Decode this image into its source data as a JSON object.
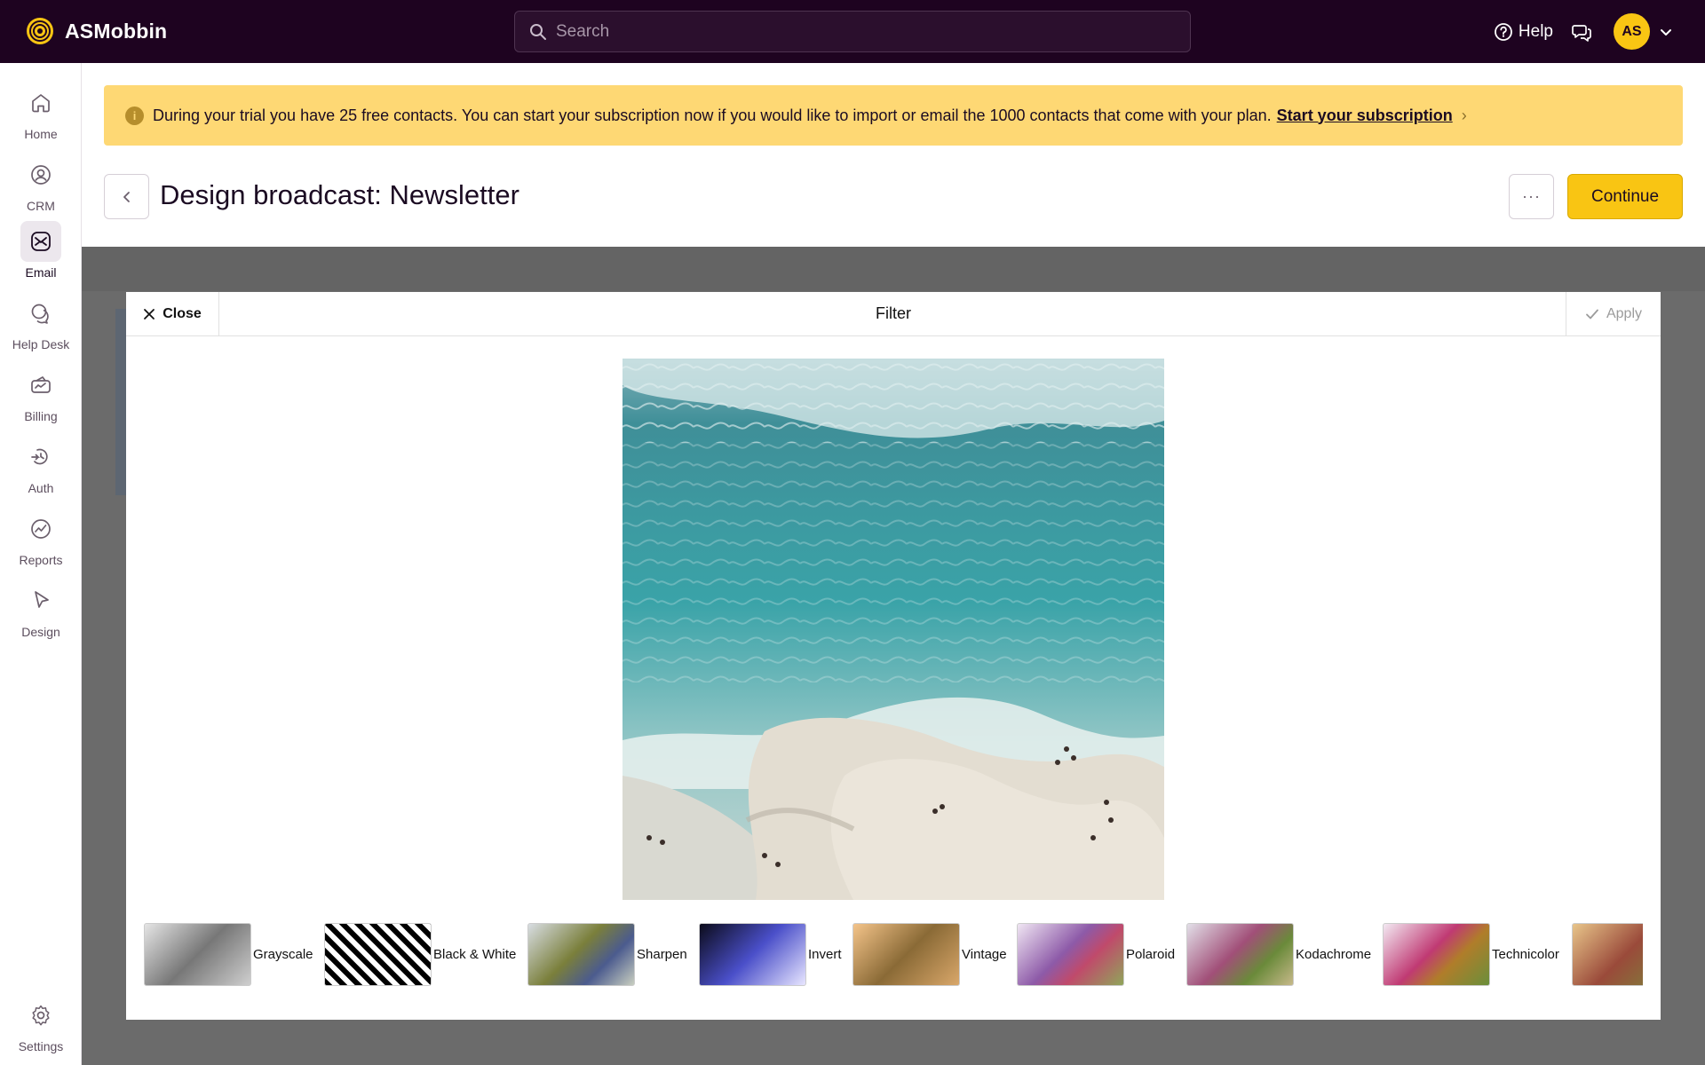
{
  "app": {
    "name": "ASMobbin",
    "search_placeholder": "Search",
    "help_label": "Help",
    "avatar_initials": "AS"
  },
  "sidebar": {
    "items": [
      {
        "label": "Home",
        "icon": "home-icon"
      },
      {
        "label": "CRM",
        "icon": "crm-icon"
      },
      {
        "label": "Email",
        "icon": "email-icon",
        "active": true
      },
      {
        "label": "Help Desk",
        "icon": "help-desk-icon"
      },
      {
        "label": "Billing",
        "icon": "billing-icon"
      },
      {
        "label": "Auth",
        "icon": "auth-icon"
      },
      {
        "label": "Reports",
        "icon": "reports-icon"
      },
      {
        "label": "Design",
        "icon": "design-icon"
      }
    ],
    "settings_label": "Settings"
  },
  "banner": {
    "text": "During your trial you have 25 free contacts. You can start your subscription now if you would like to import or email the 1000 contacts that come with your plan.",
    "link": "Start your subscription"
  },
  "header": {
    "title": "Design broadcast: Newsletter",
    "more_label": "···",
    "continue_label": "Continue"
  },
  "modal": {
    "close_label": "Close",
    "title": "Filter",
    "apply_label": "Apply",
    "filters": [
      {
        "label": "Grayscale"
      },
      {
        "label": "Black & White"
      },
      {
        "label": "Sharpen"
      },
      {
        "label": "Invert"
      },
      {
        "label": "Vintage"
      },
      {
        "label": "Polaroid"
      },
      {
        "label": "Kodachrome"
      },
      {
        "label": "Technicolor"
      },
      {
        "label": ""
      }
    ]
  },
  "colors": {
    "topbar": "#1e0320",
    "accent": "#f9c513",
    "banner": "#fed874"
  }
}
